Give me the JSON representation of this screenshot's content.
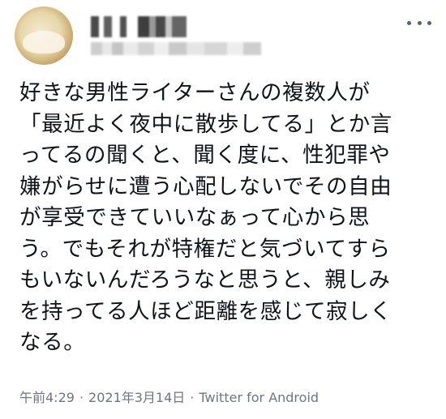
{
  "tweet": {
    "author": {
      "avatar_icon": "user-avatar-blurred",
      "name_obscured": true,
      "handle_obscured": true
    },
    "more_icon": "more-horizontal-icon",
    "body_lines": [
      "好きな男性ライターさんの複数人が",
      "「最近よく夜中に散歩してる」とか言",
      "ってるの聞くと、聞く度に、性犯罪や",
      "嫌がらせに遭う心配しないでその自由",
      "が享受できていいなぁって心から思",
      "う。でもそれが特権だと気づいてすら",
      "もいないんだろうなと思うと、親しみ",
      "を持ってる人ほど距離を感じて寂しく",
      "なる。"
    ],
    "meta": {
      "time": "午前4:29",
      "separator": "·",
      "date": "2021年3月14日",
      "source": "Twitter for Android"
    }
  },
  "colors": {
    "text": "#0f1419",
    "meta": "#6e767d",
    "icon": "#536471",
    "background": "#ffffff"
  }
}
